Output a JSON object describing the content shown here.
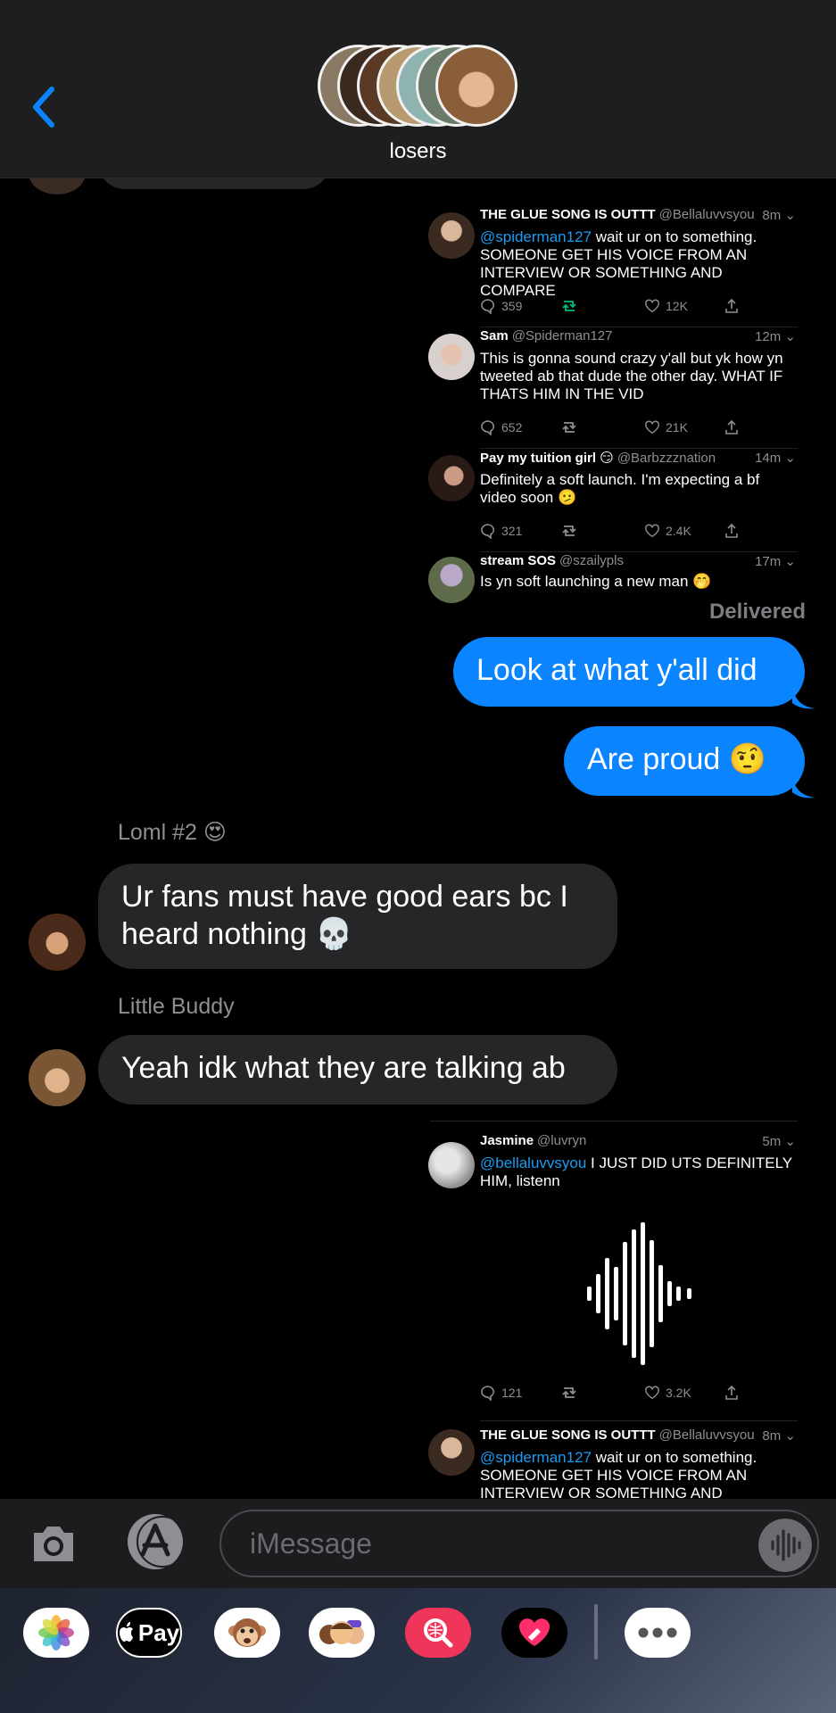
{
  "header": {
    "group_name": "losers"
  },
  "tweets_top": [
    {
      "name": "THE GLUE SONG IS OUTTT",
      "handle": "@Bellaluvvsyou",
      "time": "8m",
      "mention": "@spiderman127",
      "text": " wait ur on to something. SOMEONE GET HIS VOICE FROM AN INTERVIEW OR SOMETHING AND COMPARE",
      "replies": "359",
      "likes": "12K"
    },
    {
      "name": "Sam",
      "handle": "@Spiderman127",
      "time": "12m",
      "mention": "",
      "text": "This is gonna sound crazy y'all but yk how yn tweeted ab that dude the other day. WHAT IF THATS HIM IN THE VID",
      "replies": "652",
      "likes": "21K"
    },
    {
      "name": "Pay my tuition girl 😏",
      "handle": "@Barbzzznation",
      "time": "14m",
      "mention": "",
      "text": "Definitely a soft launch. I'm expecting a bf video soon 🫤",
      "replies": "321",
      "likes": "2.4K"
    },
    {
      "name": "stream SOS",
      "handle": "@szailypls",
      "time": "17m",
      "mention": "",
      "text": "Is yn soft launching a new man 🤭"
    }
  ],
  "status": {
    "delivered": "Delivered"
  },
  "messages": {
    "out_1": "Look at what y'all did",
    "out_2": "Are proud 🤨",
    "sender_1": "Loml #2 😍",
    "in_1": "Ur fans must have good ears bc I heard nothing 💀",
    "sender_2": "Little Buddy",
    "in_2": "Yeah idk what they are talking ab"
  },
  "tweets_bottom": [
    {
      "name": "Jasmine",
      "handle": "@luvryn",
      "time": "5m",
      "mention": "@bellaluvvsyou",
      "text": " I JUST DID UTS DEFINITELY HIM, listenn",
      "replies": "121",
      "likes": "3.2K"
    },
    {
      "name": "THE GLUE SONG IS OUTTT",
      "handle": "@Bellaluvvsyou",
      "time": "8m",
      "mention": "@spiderman127",
      "text": " wait ur on to something. SOMEONE GET HIS VOICE FROM AN INTERVIEW OR SOMETHING AND COMPARE"
    }
  ],
  "input": {
    "placeholder": "iMessage"
  },
  "tray": {
    "applepay_label": "Pay"
  },
  "colors": {
    "imessage_blue": "#0a84ff",
    "incoming_bubble": "#262628",
    "twitter_blue": "#1d9bf0",
    "retweet_green": "#00ba7c"
  }
}
